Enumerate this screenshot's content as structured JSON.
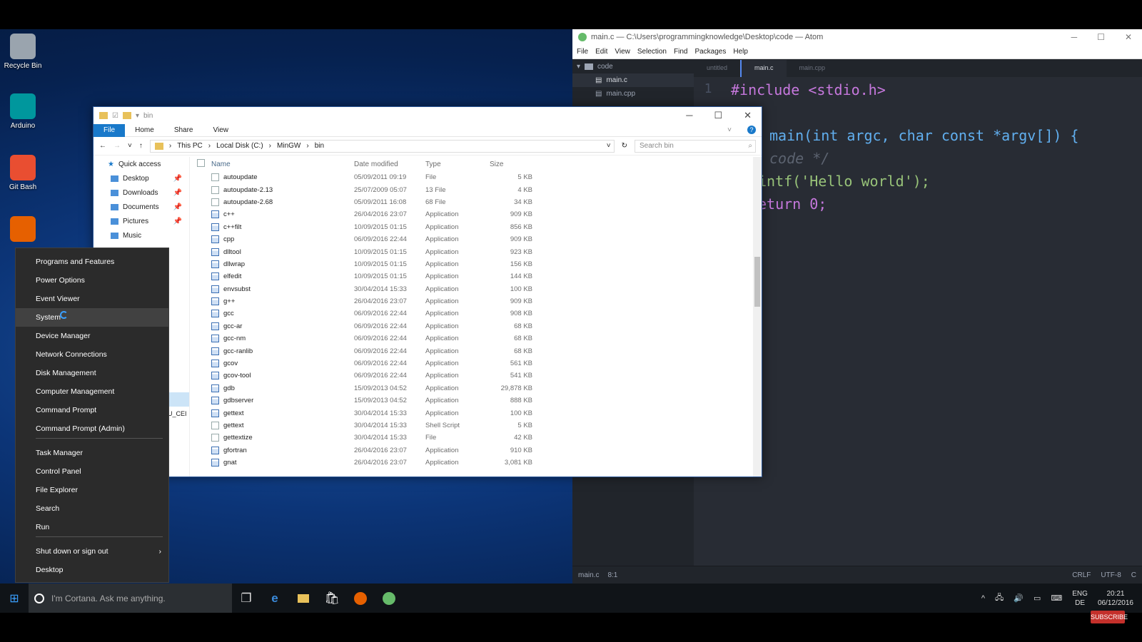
{
  "desktop_icons": [
    {
      "label": "Recycle Bin",
      "color": "#9aa4ae"
    },
    {
      "label": "Arduino",
      "color": "#00979d"
    },
    {
      "label": "Git Bash",
      "color": "#e94e31"
    },
    {
      "label": "",
      "color": "#e66000"
    }
  ],
  "atom": {
    "title": "main.c — C:\\Users\\programmingknowledge\\Desktop\\code — Atom",
    "menu": [
      "File",
      "Edit",
      "View",
      "Selection",
      "Find",
      "Packages",
      "Help"
    ],
    "tree": {
      "folder": "code",
      "files": [
        "main.c",
        "main.cpp"
      ]
    },
    "tabs": [
      "untitled",
      "main.c",
      "main.cpp"
    ],
    "line_number": "1",
    "code": {
      "include": "#include <stdio.h>",
      "main": "main(int argc, char const *argv[]) {",
      "comment": "code */",
      "printf": "intf('Hello world');",
      "ret": "eturn 0;"
    },
    "status_left": [
      "main.c",
      "8:1"
    ],
    "status_right": [
      "CRLF",
      "UTF-8",
      "C"
    ]
  },
  "explorer": {
    "title": "bin",
    "ribbon": [
      "File",
      "Home",
      "Share",
      "View"
    ],
    "breadcrumb": [
      "This PC",
      "Local Disk (C:)",
      "MinGW",
      "bin"
    ],
    "search_placeholder": "Search bin",
    "nav": [
      {
        "label": "Quick access",
        "pin": false
      },
      {
        "label": "Desktop",
        "pin": true
      },
      {
        "label": "Downloads",
        "pin": true
      },
      {
        "label": "Documents",
        "pin": true
      },
      {
        "label": "Pictures",
        "pin": true
      },
      {
        "label": "Music",
        "pin": false
      }
    ],
    "peek_label": "U_CEI",
    "columns": [
      "Name",
      "Date modified",
      "Type",
      "Size"
    ],
    "files": [
      [
        "autoupdate",
        "05/09/2011 09:19",
        "File",
        "5 KB",
        "file"
      ],
      [
        "autoupdate-2.13",
        "25/07/2009 05:07",
        "13 File",
        "4 KB",
        "file"
      ],
      [
        "autoupdate-2.68",
        "05/09/2011 16:08",
        "68 File",
        "34 KB",
        "file"
      ],
      [
        "c++",
        "26/04/2016 23:07",
        "Application",
        "909 KB",
        "app"
      ],
      [
        "c++filt",
        "10/09/2015 01:15",
        "Application",
        "856 KB",
        "app"
      ],
      [
        "cpp",
        "06/09/2016 22:44",
        "Application",
        "909 KB",
        "app"
      ],
      [
        "dlltool",
        "10/09/2015 01:15",
        "Application",
        "923 KB",
        "app"
      ],
      [
        "dllwrap",
        "10/09/2015 01:15",
        "Application",
        "156 KB",
        "app"
      ],
      [
        "elfedit",
        "10/09/2015 01:15",
        "Application",
        "144 KB",
        "app"
      ],
      [
        "envsubst",
        "30/04/2014 15:33",
        "Application",
        "100 KB",
        "app"
      ],
      [
        "g++",
        "26/04/2016 23:07",
        "Application",
        "909 KB",
        "app"
      ],
      [
        "gcc",
        "06/09/2016 22:44",
        "Application",
        "908 KB",
        "app"
      ],
      [
        "gcc-ar",
        "06/09/2016 22:44",
        "Application",
        "68 KB",
        "app"
      ],
      [
        "gcc-nm",
        "06/09/2016 22:44",
        "Application",
        "68 KB",
        "app"
      ],
      [
        "gcc-ranlib",
        "06/09/2016 22:44",
        "Application",
        "68 KB",
        "app"
      ],
      [
        "gcov",
        "06/09/2016 22:44",
        "Application",
        "561 KB",
        "app"
      ],
      [
        "gcov-tool",
        "06/09/2016 22:44",
        "Application",
        "541 KB",
        "app"
      ],
      [
        "gdb",
        "15/09/2013 04:52",
        "Application",
        "29,878 KB",
        "app"
      ],
      [
        "gdbserver",
        "15/09/2013 04:52",
        "Application",
        "888 KB",
        "app"
      ],
      [
        "gettext",
        "30/04/2014 15:33",
        "Application",
        "100 KB",
        "app"
      ],
      [
        "gettext",
        "30/04/2014 15:33",
        "Shell Script",
        "5 KB",
        "file"
      ],
      [
        "gettextize",
        "30/04/2014 15:33",
        "File",
        "42 KB",
        "file"
      ],
      [
        "gfortran",
        "26/04/2016 23:07",
        "Application",
        "910 KB",
        "app"
      ],
      [
        "gnat",
        "26/04/2016 23:07",
        "Application",
        "3,081 KB",
        "app"
      ]
    ]
  },
  "power_menu": {
    "items": [
      "Programs and Features",
      "Power Options",
      "Event Viewer",
      "System",
      "Device Manager",
      "Network Connections",
      "Disk Management",
      "Computer Management",
      "Command Prompt",
      "Command Prompt (Admin)",
      "Task Manager",
      "Control Panel",
      "File Explorer",
      "Search",
      "Run",
      "Shut down or sign out",
      "Desktop"
    ],
    "highlighted": "System"
  },
  "taskbar": {
    "cortana_placeholder": "I'm Cortana. Ask me anything.",
    "lang1": "ENG",
    "lang2": "DE",
    "time": "20:21",
    "date": "06/12/2016"
  },
  "subscribe_label": "SUBSCRIBE"
}
